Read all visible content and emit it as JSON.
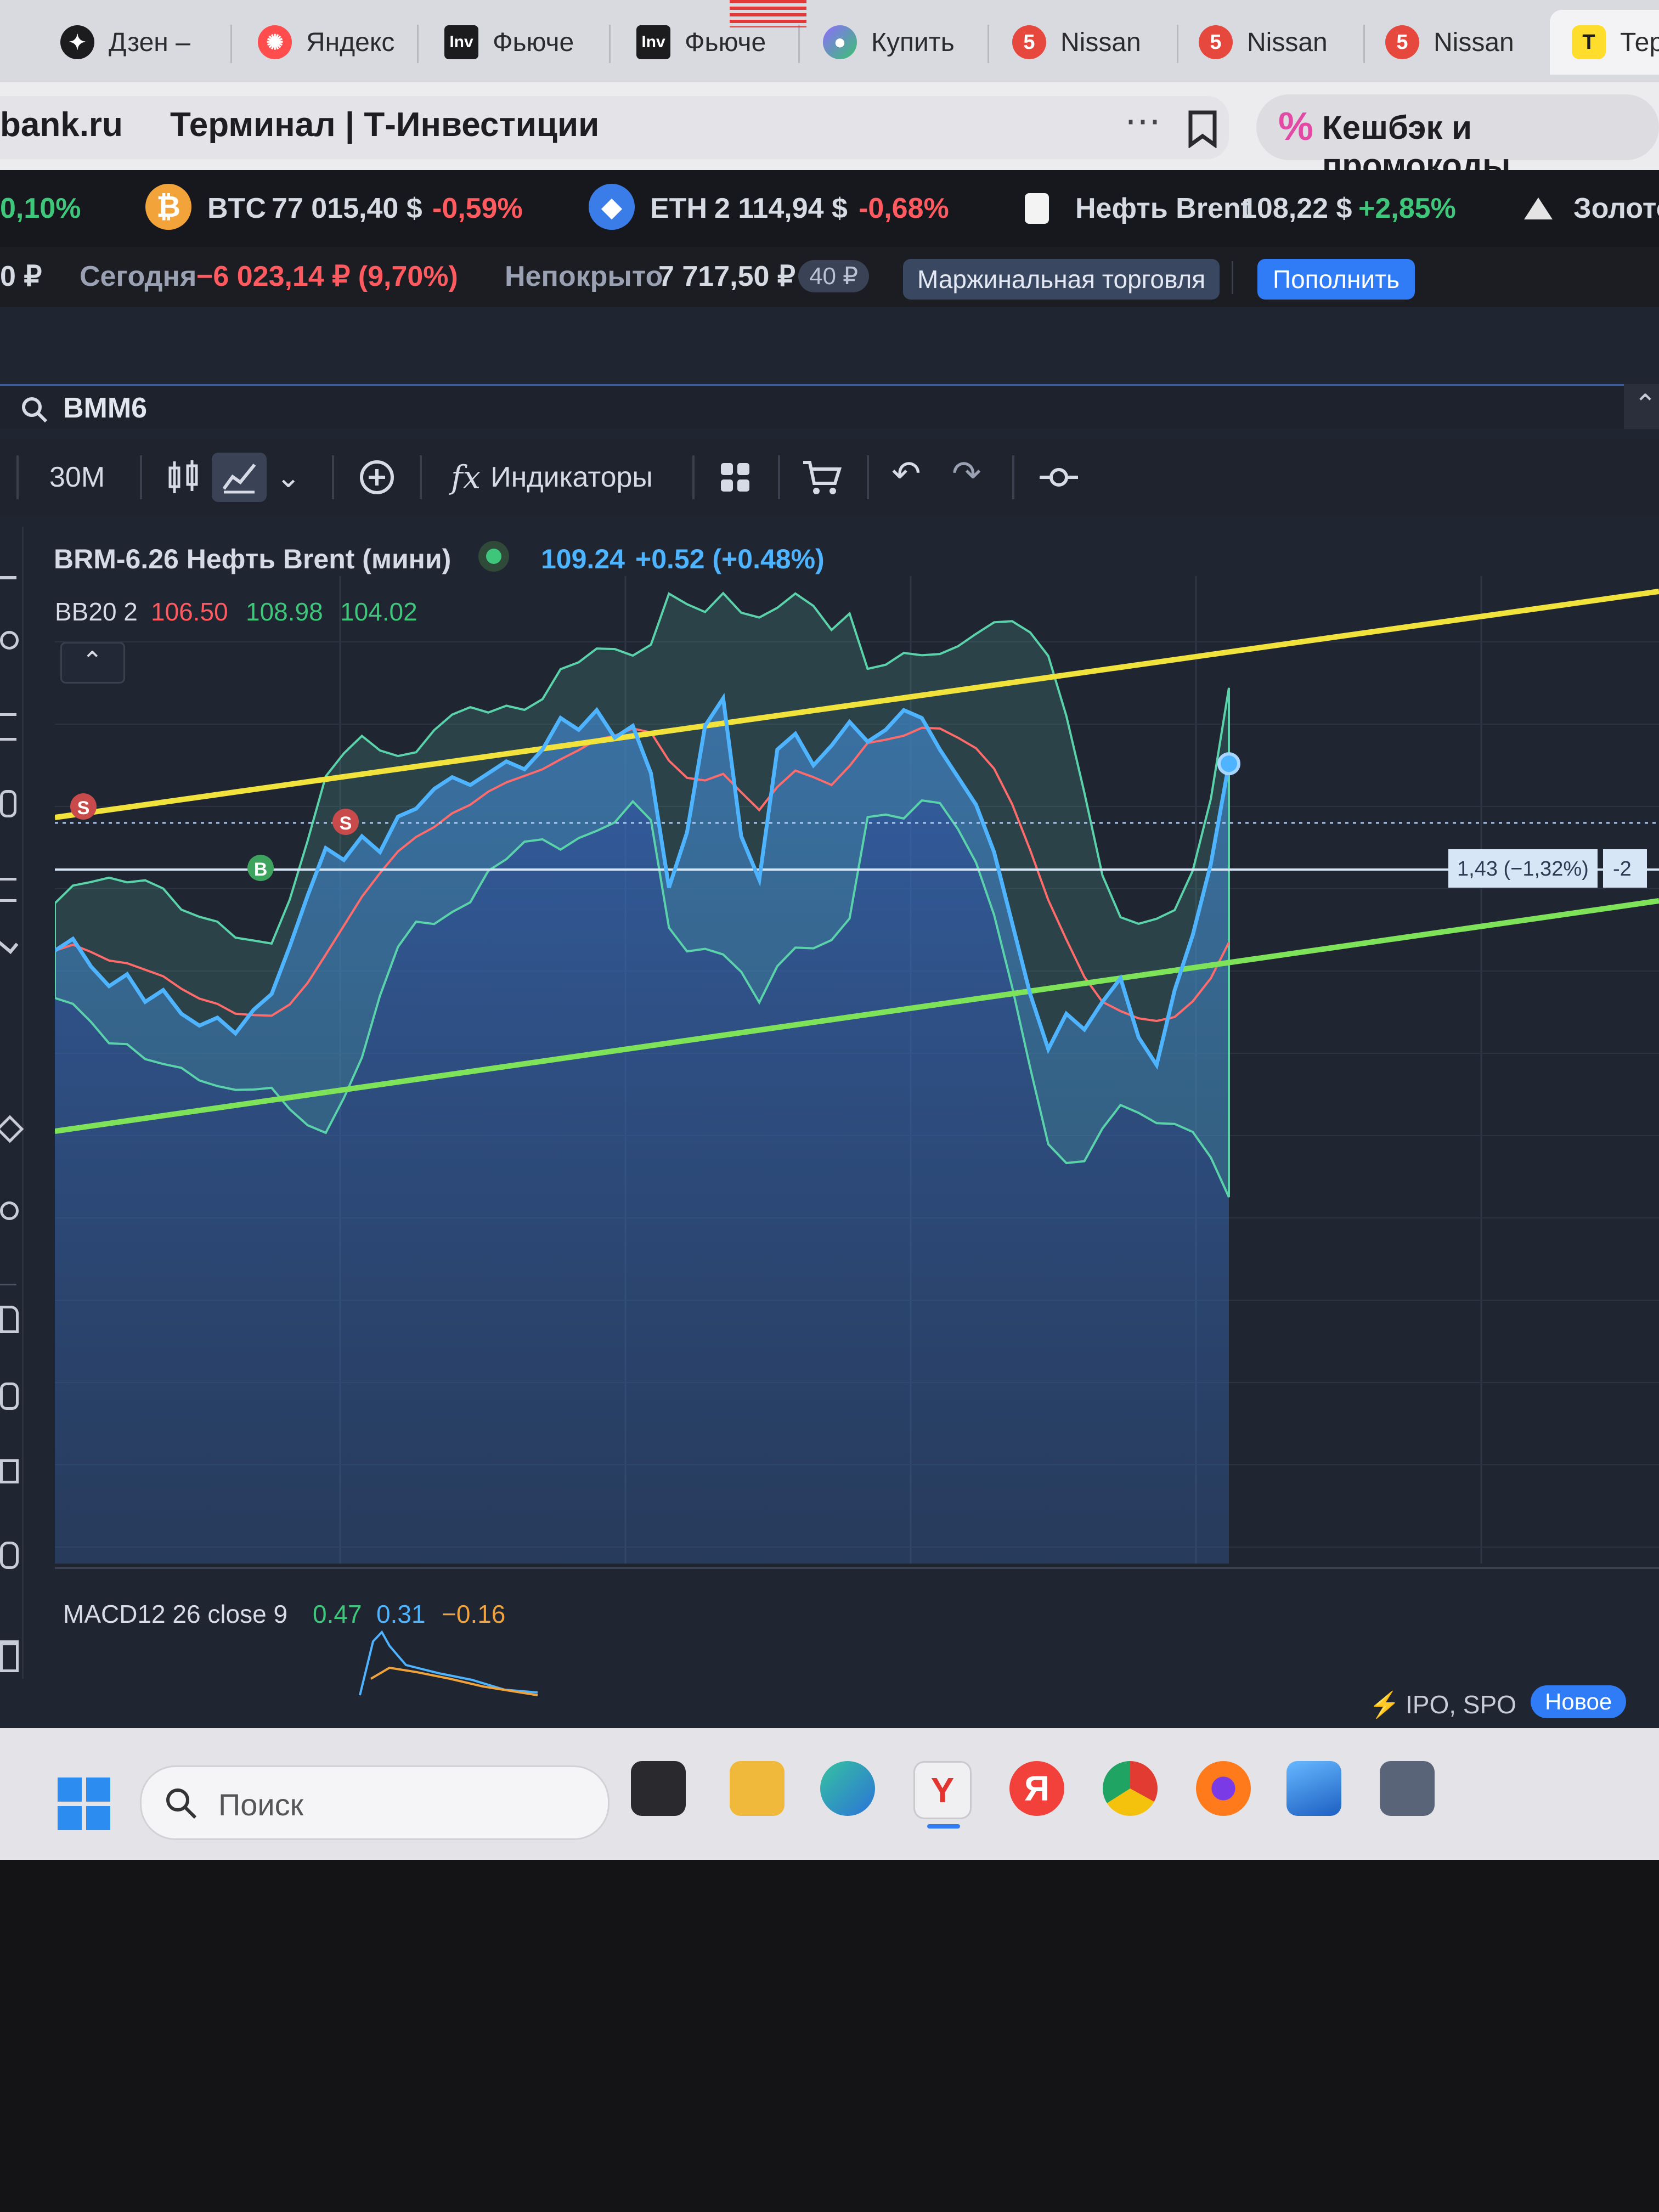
{
  "tabs": [
    {
      "label": "Дзен –",
      "icon": "zen-icon"
    },
    {
      "label": "Яндекс",
      "icon": "yandex-flower-icon"
    },
    {
      "label": "Фьюче",
      "icon": "investing-icon",
      "badge": "Inv"
    },
    {
      "label": "Фьюче",
      "icon": "investing-icon",
      "badge": "Inv"
    },
    {
      "label": "Купить",
      "icon": "marketplace-icon"
    },
    {
      "label": "Nissan",
      "icon": "drom-icon",
      "badge": "5"
    },
    {
      "label": "Nissan",
      "icon": "drom-icon",
      "badge": "5"
    },
    {
      "label": "Nissan",
      "icon": "drom-icon",
      "badge": "5"
    },
    {
      "label": "Тер",
      "icon": "tbank-icon",
      "badge": "T"
    }
  ],
  "address": {
    "domain": "bank.ru",
    "page_title": "Терминал | Т-Инвестиции",
    "more": "⋯",
    "promo_icon": "%",
    "promo_label": "Кешбэк и промокоды"
  },
  "ticker": {
    "lead_change": "0,10%",
    "btc": {
      "name": "BTC",
      "price": "77 015,40 $",
      "change": "-0,59%"
    },
    "eth": {
      "name": "ETH",
      "price": "2 114,94 $",
      "change": "-0,68%"
    },
    "brent": {
      "name": "Нефть Brent",
      "price": "108,22 $",
      "change": "+2,85%"
    },
    "gold": {
      "name": "Золото"
    }
  },
  "account": {
    "lead": "0 ₽",
    "today_label": "Сегодня",
    "today_value": "−6 023,14 ₽ (9,70%)",
    "uncovered_label": "Непокрыто",
    "uncovered_value": "7 717,50 ₽",
    "uncovered_badge": "40 ₽",
    "margin_button": "Маржинальная торговля",
    "deposit_button": "Пополнить"
  },
  "search": {
    "value": "BMM6"
  },
  "toolbar": {
    "interval": "30M",
    "indicators": "Индикаторы"
  },
  "instrument": {
    "name": "BRM-6.26 Нефть Brent (мини)",
    "price": "109.24",
    "change": "+0.52 (+0.48%)"
  },
  "bb": {
    "label": "BB20 2",
    "upper": "106.50",
    "middle": "108.98",
    "lower": "104.02"
  },
  "macd": {
    "label": "MACD12 26 close 9",
    "v1": "0.47",
    "v2": "0.31",
    "v3": "−0.16"
  },
  "position_label": {
    "value": "1,43 (−1,32%)",
    "qty": "-2"
  },
  "markers": {
    "sell": "S",
    "buy": "B"
  },
  "ipo": {
    "label": "IPO, SPO",
    "badge": "Новое"
  },
  "taskbar": {
    "search_placeholder": "Поиск",
    "yandex_letter": "Я"
  },
  "colors": {
    "up": "#3ec77a",
    "down": "#ff5a5f",
    "price_line": "#4fb4ff",
    "trend_upper": "#f2e23c",
    "trend_lower": "#7fe35a",
    "accent": "#2f7cf6"
  },
  "chart_data": {
    "type": "line",
    "series": [
      {
        "name": "BRM-6.26 Нефть Brent (мини)",
        "values": [
          104.5,
          104.8,
          104.1,
          103.6,
          103.9,
          103.2,
          103.5,
          102.9,
          102.6,
          102.8,
          102.4,
          103.0,
          103.4,
          104.6,
          105.9,
          107.1,
          106.8,
          107.4,
          107.0,
          107.9,
          108.1,
          108.6,
          108.9,
          108.7,
          109.0,
          109.3,
          109.1,
          109.6,
          110.4,
          110.1,
          110.6,
          109.9,
          110.2,
          109.0,
          106.1,
          107.5,
          110.2,
          110.9,
          107.4,
          106.3,
          109.6,
          110.0,
          109.2,
          109.7,
          110.3,
          109.8,
          110.1,
          110.6,
          110.4,
          109.6,
          108.9,
          108.2,
          107.0,
          105.2,
          103.4,
          102.0,
          102.9,
          102.5,
          103.2,
          103.8,
          102.3,
          101.6,
          103.5,
          104.9,
          106.7,
          109.24
        ]
      }
    ]
  }
}
